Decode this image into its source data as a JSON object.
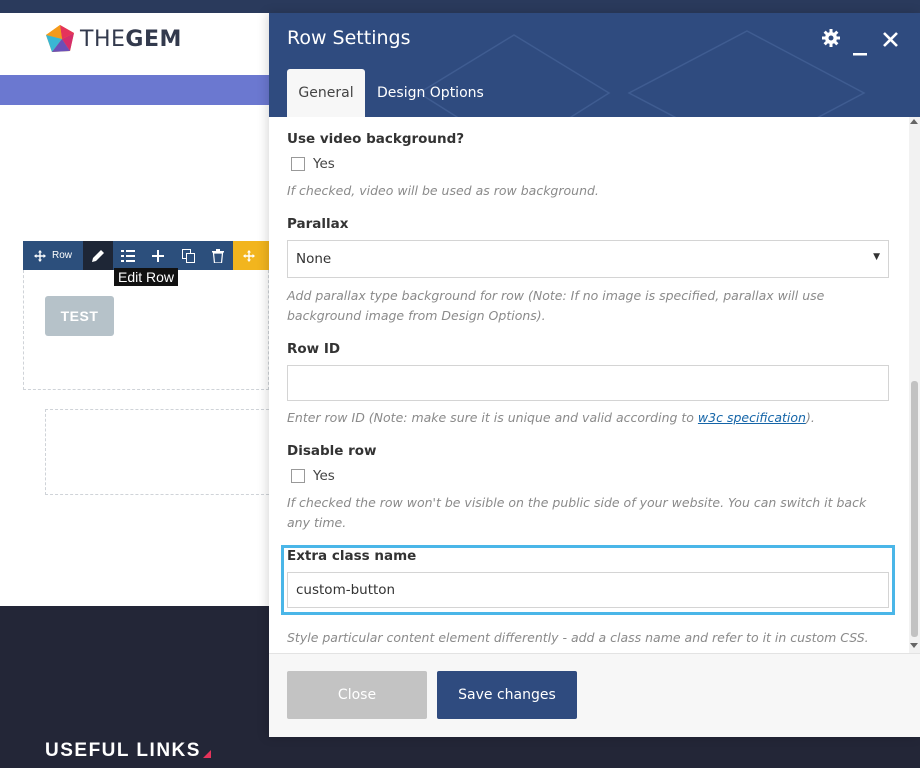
{
  "site": {
    "logo_the": "THE",
    "logo_gem": "GEM",
    "footer_heading": "USEFUL LINKS"
  },
  "builder": {
    "row_label": "Row",
    "tooltip": "Edit Row",
    "test_button": "TEST",
    "accent_color": "#f2b51e",
    "toolbar_color": "#2c4f7c"
  },
  "modal": {
    "title": "Row Settings",
    "tabs": [
      {
        "label": "General",
        "active": true
      },
      {
        "label": "Design Options",
        "active": false
      }
    ],
    "header_color": "#2f4b7f",
    "fields": {
      "video_bg": {
        "label": "Use video background?",
        "checkbox_label": "Yes",
        "checked": false,
        "help": "If checked, video will be used as row background."
      },
      "parallax": {
        "label": "Parallax",
        "value": "None",
        "help": "Add parallax type background for row (Note: If no image is specified, parallax will use background image from Design Options)."
      },
      "row_id": {
        "label": "Row ID",
        "value": "",
        "help_before": "Enter row ID (Note: make sure it is unique and valid according to ",
        "help_link": "w3c specification",
        "help_after": ")."
      },
      "disable_row": {
        "label": "Disable row",
        "checkbox_label": "Yes",
        "checked": false,
        "help": "If checked the row won't be visible on the public side of your website. You can switch it back any time."
      },
      "extra_class": {
        "label": "Extra class name",
        "value": "custom-button",
        "help": "Style particular content element differently - add a class name and refer to it in custom CSS.",
        "highlight_color": "#4ab6e8"
      }
    },
    "buttons": {
      "close": "Close",
      "save": "Save changes"
    }
  }
}
